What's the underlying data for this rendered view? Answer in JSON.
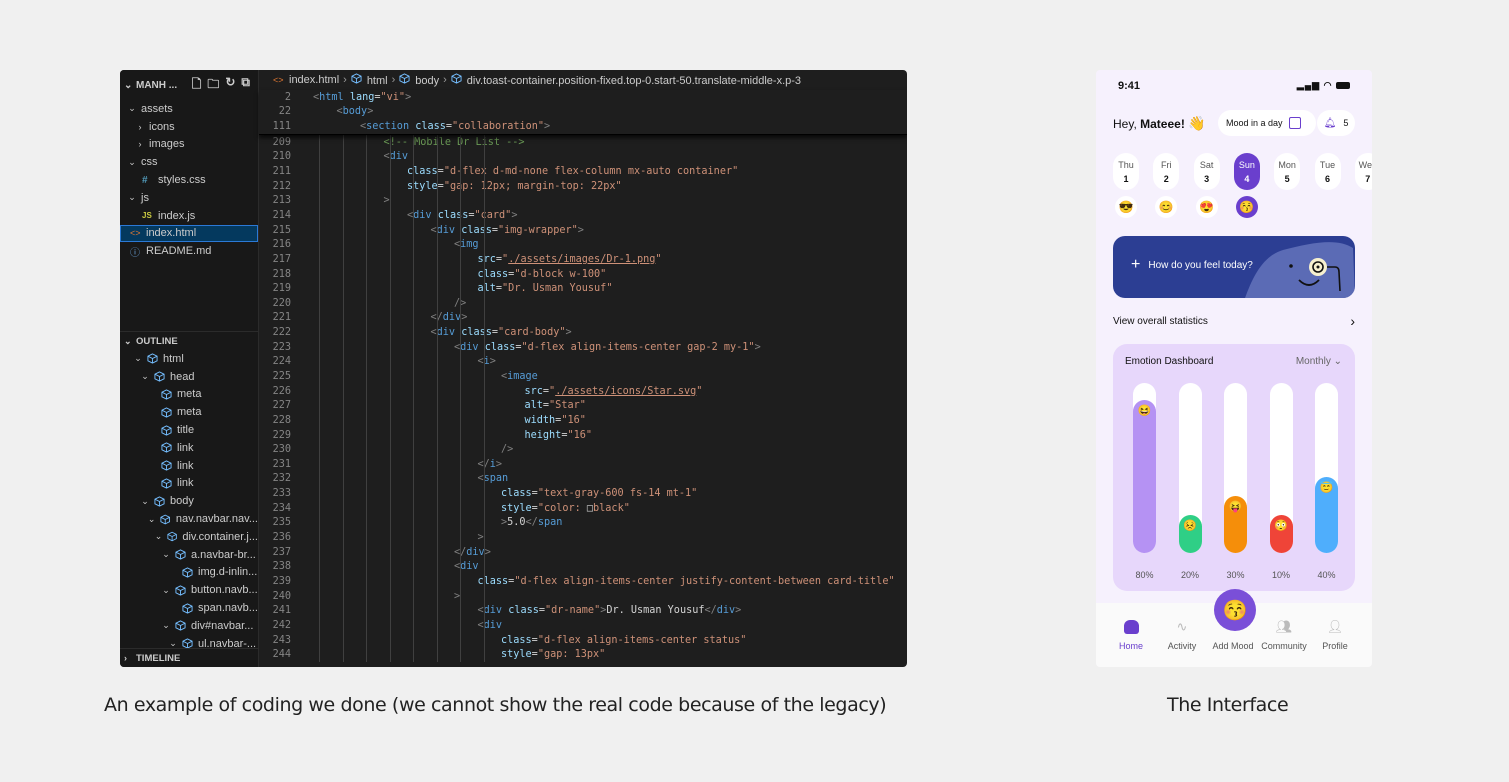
{
  "editor": {
    "explorer": {
      "title": "MANH ...",
      "items": [
        {
          "label": "assets",
          "type": "folder",
          "expanded": true,
          "depth": 0
        },
        {
          "label": "icons",
          "type": "folder",
          "expanded": false,
          "depth": 1
        },
        {
          "label": "images",
          "type": "folder",
          "expanded": false,
          "depth": 1
        },
        {
          "label": "css",
          "type": "folder",
          "expanded": true,
          "depth": 0
        },
        {
          "label": "styles.css",
          "type": "css",
          "depth": 1
        },
        {
          "label": "js",
          "type": "folder",
          "expanded": true,
          "depth": 0
        },
        {
          "label": "index.js",
          "type": "js",
          "depth": 1
        },
        {
          "label": "index.html",
          "type": "html",
          "depth": 0,
          "selected": true
        },
        {
          "label": "README.md",
          "type": "info",
          "depth": 0
        }
      ]
    },
    "outline": {
      "title": "OUTLINE",
      "items": [
        {
          "label": "html",
          "depth": 0,
          "chev": true
        },
        {
          "label": "head",
          "depth": 1,
          "chev": true
        },
        {
          "label": "meta",
          "depth": 2
        },
        {
          "label": "meta",
          "depth": 2
        },
        {
          "label": "title",
          "depth": 2
        },
        {
          "label": "link",
          "depth": 2
        },
        {
          "label": "link",
          "depth": 2
        },
        {
          "label": "link",
          "depth": 2
        },
        {
          "label": "body",
          "depth": 1,
          "chev": true
        },
        {
          "label": "nav.navbar.nav...",
          "depth": 2,
          "chev": true
        },
        {
          "label": "div.container.j...",
          "depth": 3,
          "chev": true
        },
        {
          "label": "a.navbar-br...",
          "depth": 4,
          "chev": true
        },
        {
          "label": "img.d-inlin...",
          "depth": 5
        },
        {
          "label": "button.navb...",
          "depth": 4,
          "chev": true
        },
        {
          "label": "span.navb...",
          "depth": 5
        },
        {
          "label": "div#navbar...",
          "depth": 4,
          "chev": true
        },
        {
          "label": "ul.navbar-...",
          "depth": 5,
          "chev": true
        }
      ]
    },
    "timeline": {
      "title": "TIMELINE"
    },
    "breadcrumb": [
      "index.html",
      "html",
      "body",
      "div.toast-container.position-fixed.top-0.start-50.translate-middle-x.p-3"
    ],
    "sticky_lines": [
      {
        "n": "2",
        "indent": 0,
        "tokens": [
          [
            "br",
            "<"
          ],
          [
            "tag",
            "html"
          ],
          [
            "txt",
            " "
          ],
          [
            "attr",
            "lang"
          ],
          [
            "txt",
            "="
          ],
          [
            "str",
            "\"vi\""
          ],
          [
            "br",
            ">"
          ]
        ]
      },
      {
        "n": "22",
        "indent": 1,
        "tokens": [
          [
            "br",
            "<"
          ],
          [
            "tag",
            "body"
          ],
          [
            "br",
            ">"
          ]
        ]
      },
      {
        "n": "111",
        "indent": 2,
        "tokens": [
          [
            "br",
            "<"
          ],
          [
            "tag",
            "section"
          ],
          [
            "txt",
            " "
          ],
          [
            "attr",
            "class"
          ],
          [
            "txt",
            "="
          ],
          [
            "str",
            "\"collaboration\""
          ],
          [
            "br",
            ">"
          ]
        ]
      }
    ],
    "lines": [
      {
        "n": "209",
        "indent": 3,
        "tokens": [
          [
            "com",
            "<!-- Mobile Dr List -->"
          ]
        ]
      },
      {
        "n": "210",
        "indent": 3,
        "tokens": [
          [
            "br",
            "<"
          ],
          [
            "tag",
            "div"
          ]
        ]
      },
      {
        "n": "211",
        "indent": 4,
        "tokens": [
          [
            "attr",
            "class"
          ],
          [
            "txt",
            "="
          ],
          [
            "str",
            "\"d-flex d-md-none flex-column mx-auto container\""
          ]
        ]
      },
      {
        "n": "212",
        "indent": 4,
        "tokens": [
          [
            "attr",
            "style"
          ],
          [
            "txt",
            "="
          ],
          [
            "str",
            "\"gap: 12px; margin-top: 22px\""
          ]
        ]
      },
      {
        "n": "213",
        "indent": 3,
        "tokens": [
          [
            "br",
            ">"
          ]
        ]
      },
      {
        "n": "214",
        "indent": 4,
        "tokens": [
          [
            "br",
            "<"
          ],
          [
            "tag",
            "div"
          ],
          [
            "txt",
            " "
          ],
          [
            "attr",
            "class"
          ],
          [
            "txt",
            "="
          ],
          [
            "str",
            "\"card\""
          ],
          [
            "br",
            ">"
          ]
        ]
      },
      {
        "n": "215",
        "indent": 5,
        "tokens": [
          [
            "br",
            "<"
          ],
          [
            "tag",
            "div"
          ],
          [
            "txt",
            " "
          ],
          [
            "attr",
            "class"
          ],
          [
            "txt",
            "="
          ],
          [
            "str",
            "\"img-wrapper\""
          ],
          [
            "br",
            ">"
          ]
        ]
      },
      {
        "n": "216",
        "indent": 6,
        "tokens": [
          [
            "br",
            "<"
          ],
          [
            "tag",
            "img"
          ]
        ]
      },
      {
        "n": "217",
        "indent": 7,
        "tokens": [
          [
            "attr",
            "src"
          ],
          [
            "txt",
            "="
          ],
          [
            "str",
            "\""
          ],
          [
            "link",
            "./assets/images/Dr-1.png"
          ],
          [
            "str",
            "\""
          ]
        ]
      },
      {
        "n": "218",
        "indent": 7,
        "tokens": [
          [
            "attr",
            "class"
          ],
          [
            "txt",
            "="
          ],
          [
            "str",
            "\"d-block w-100\""
          ]
        ]
      },
      {
        "n": "219",
        "indent": 7,
        "tokens": [
          [
            "attr",
            "alt"
          ],
          [
            "txt",
            "="
          ],
          [
            "str",
            "\"Dr. Usman Yousuf\""
          ]
        ]
      },
      {
        "n": "220",
        "indent": 6,
        "tokens": [
          [
            "br",
            "/>"
          ]
        ]
      },
      {
        "n": "221",
        "indent": 5,
        "tokens": [
          [
            "br",
            "</"
          ],
          [
            "tag",
            "div"
          ],
          [
            "br",
            ">"
          ]
        ]
      },
      {
        "n": "222",
        "indent": 5,
        "tokens": [
          [
            "br",
            "<"
          ],
          [
            "tag",
            "div"
          ],
          [
            "txt",
            " "
          ],
          [
            "attr",
            "class"
          ],
          [
            "txt",
            "="
          ],
          [
            "str",
            "\"card-body\""
          ],
          [
            "br",
            ">"
          ]
        ]
      },
      {
        "n": "223",
        "indent": 6,
        "tokens": [
          [
            "br",
            "<"
          ],
          [
            "tag",
            "div"
          ],
          [
            "txt",
            " "
          ],
          [
            "attr",
            "class"
          ],
          [
            "txt",
            "="
          ],
          [
            "str",
            "\"d-flex align-items-center gap-2 my-1\""
          ],
          [
            "br",
            ">"
          ]
        ]
      },
      {
        "n": "224",
        "indent": 7,
        "tokens": [
          [
            "br",
            "<"
          ],
          [
            "tag",
            "i"
          ],
          [
            "br",
            ">"
          ]
        ]
      },
      {
        "n": "225",
        "indent": 8,
        "tokens": [
          [
            "br",
            "<"
          ],
          [
            "tag",
            "image"
          ]
        ]
      },
      {
        "n": "226",
        "indent": 9,
        "tokens": [
          [
            "attr",
            "src"
          ],
          [
            "txt",
            "="
          ],
          [
            "str",
            "\""
          ],
          [
            "link",
            "./assets/icons/Star.svg"
          ],
          [
            "str",
            "\""
          ]
        ]
      },
      {
        "n": "227",
        "indent": 9,
        "tokens": [
          [
            "attr",
            "alt"
          ],
          [
            "txt",
            "="
          ],
          [
            "str",
            "\"Star\""
          ]
        ]
      },
      {
        "n": "228",
        "indent": 9,
        "tokens": [
          [
            "attr",
            "width"
          ],
          [
            "txt",
            "="
          ],
          [
            "str",
            "\"16\""
          ]
        ]
      },
      {
        "n": "229",
        "indent": 9,
        "tokens": [
          [
            "attr",
            "height"
          ],
          [
            "txt",
            "="
          ],
          [
            "str",
            "\"16\""
          ]
        ]
      },
      {
        "n": "230",
        "indent": 8,
        "tokens": [
          [
            "br",
            "/>"
          ]
        ]
      },
      {
        "n": "231",
        "indent": 7,
        "tokens": [
          [
            "br",
            "</"
          ],
          [
            "tag",
            "i"
          ],
          [
            "br",
            ">"
          ]
        ]
      },
      {
        "n": "232",
        "indent": 7,
        "tokens": [
          [
            "br",
            "<"
          ],
          [
            "tag",
            "span"
          ]
        ]
      },
      {
        "n": "233",
        "indent": 8,
        "tokens": [
          [
            "attr",
            "class"
          ],
          [
            "txt",
            "="
          ],
          [
            "str",
            "\"text-gray-600 fs-14 mt-1\""
          ]
        ]
      },
      {
        "n": "234",
        "indent": 8,
        "tokens": [
          [
            "attr",
            "style"
          ],
          [
            "txt",
            "="
          ],
          [
            "str",
            "\"color: "
          ],
          [
            "txt",
            "□"
          ],
          [
            "str",
            "black\""
          ]
        ]
      },
      {
        "n": "235",
        "indent": 8,
        "tokens": [
          [
            "br",
            ">"
          ],
          [
            "txt",
            "5.0"
          ],
          [
            "br",
            "</"
          ],
          [
            "tag",
            "span"
          ]
        ]
      },
      {
        "n": "236",
        "indent": 7,
        "tokens": [
          [
            "br",
            ">"
          ]
        ]
      },
      {
        "n": "237",
        "indent": 6,
        "tokens": [
          [
            "br",
            "</"
          ],
          [
            "tag",
            "div"
          ],
          [
            "br",
            ">"
          ]
        ]
      },
      {
        "n": "238",
        "indent": 6,
        "tokens": [
          [
            "br",
            "<"
          ],
          [
            "tag",
            "div"
          ]
        ]
      },
      {
        "n": "239",
        "indent": 7,
        "tokens": [
          [
            "attr",
            "class"
          ],
          [
            "txt",
            "="
          ],
          [
            "str",
            "\"d-flex align-items-center justify-content-between card-title\""
          ]
        ]
      },
      {
        "n": "240",
        "indent": 6,
        "tokens": [
          [
            "br",
            ">"
          ]
        ]
      },
      {
        "n": "241",
        "indent": 7,
        "tokens": [
          [
            "br",
            "<"
          ],
          [
            "tag",
            "div"
          ],
          [
            "txt",
            " "
          ],
          [
            "attr",
            "class"
          ],
          [
            "txt",
            "="
          ],
          [
            "str",
            "\"dr-name\""
          ],
          [
            "br",
            ">"
          ],
          [
            "txt",
            "Dr. Usman Yousuf"
          ],
          [
            "br",
            "</"
          ],
          [
            "tag",
            "div"
          ],
          [
            "br",
            ">"
          ]
        ]
      },
      {
        "n": "242",
        "indent": 7,
        "tokens": [
          [
            "br",
            "<"
          ],
          [
            "tag",
            "div"
          ]
        ]
      },
      {
        "n": "243",
        "indent": 8,
        "tokens": [
          [
            "attr",
            "class"
          ],
          [
            "txt",
            "="
          ],
          [
            "str",
            "\"d-flex align-items-center status\""
          ]
        ]
      },
      {
        "n": "244",
        "indent": 8,
        "tokens": [
          [
            "attr",
            "style"
          ],
          [
            "txt",
            "="
          ],
          [
            "str",
            "\"gap: 13px\""
          ]
        ]
      }
    ]
  },
  "captions": {
    "left": "An example of coding we done (we cannot show the real code because of the legacy)",
    "right": "The Interface"
  },
  "app": {
    "status_time": "9:41",
    "greeting_prefix": "Hey, ",
    "greeting_name": "Mateee!",
    "greeting_emoji": "👋",
    "mood_pill_label": "Mood in a day",
    "notification_count": "5",
    "days": [
      {
        "name": "Thu",
        "num": "1",
        "emoji": "😎"
      },
      {
        "name": "Fri",
        "num": "2",
        "emoji": "😊"
      },
      {
        "name": "Sat",
        "num": "3",
        "emoji": "😍"
      },
      {
        "name": "Sun",
        "num": "4",
        "emoji": "😚",
        "active": true
      },
      {
        "name": "Mon",
        "num": "5"
      },
      {
        "name": "Tue",
        "num": "6"
      },
      {
        "name": "Wed",
        "num": "7"
      }
    ],
    "banner_label": "How do you feel today?",
    "stats_link": "View overall statistics",
    "dashboard": {
      "title": "Emotion Dashboard",
      "range": "Monthly",
      "bars": [
        {
          "percent": 80,
          "label": "80%",
          "color": "#b592f3",
          "emoji": "😆"
        },
        {
          "percent": 20,
          "label": "20%",
          "color": "#2fcf86",
          "emoji": "😣"
        },
        {
          "percent": 30,
          "label": "30%",
          "color": "#f58e0a",
          "emoji": "😝"
        },
        {
          "percent": 10,
          "label": "10%",
          "color": "#ef4438",
          "emoji": "😳"
        },
        {
          "percent": 40,
          "label": "40%",
          "color": "#4faefc",
          "emoji": "😇"
        }
      ]
    },
    "fab_emoji": "😚",
    "tabs": [
      {
        "label": "Home",
        "active": true
      },
      {
        "label": "Activity"
      },
      {
        "label": "Add Mood"
      },
      {
        "label": "Community"
      },
      {
        "label": "Profile"
      }
    ],
    "colors": {
      "accent": "#6a3fcd",
      "banner": "#2c3e93",
      "dashboard_bg": "#e7d7fb"
    }
  }
}
